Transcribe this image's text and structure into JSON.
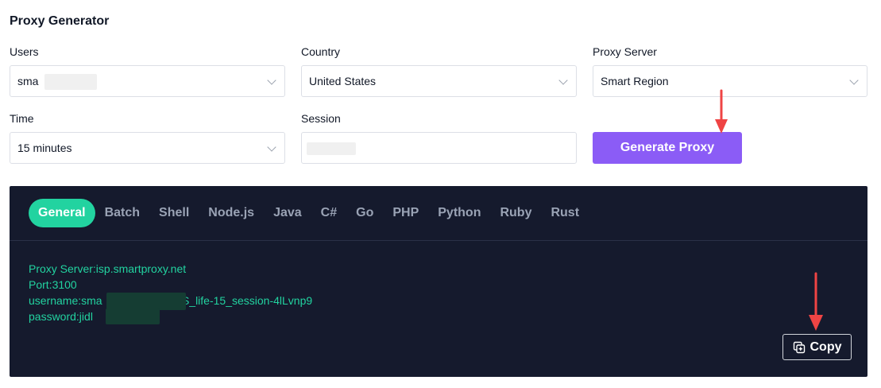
{
  "page": {
    "title": "Proxy Generator"
  },
  "form": {
    "users": {
      "label": "Users",
      "value": "sma"
    },
    "country": {
      "label": "Country",
      "value": "United States"
    },
    "proxy_server": {
      "label": "Proxy Server",
      "value": "Smart Region"
    },
    "time": {
      "label": "Time",
      "value": "15 minutes"
    },
    "session": {
      "label": "Session",
      "value": ""
    },
    "generate_label": "Generate Proxy"
  },
  "code": {
    "tabs": [
      "General",
      "Batch",
      "Shell",
      "Node.js",
      "Java",
      "C#",
      "Go",
      "PHP",
      "Python",
      "Ruby",
      "Rust"
    ],
    "active_tab": "General",
    "lines": [
      "Proxy Server:isp.smartproxy.net",
      "Port:3100",
      "username:sma                    a-US_life-15_session-4lLvnp9",
      "password:jidl"
    ],
    "copy_label": "Copy"
  },
  "colors": {
    "accent_purple": "#8b5cf6",
    "accent_green": "#22d3a0",
    "panel_bg": "#151a2d",
    "arrow_red": "#ef4444"
  }
}
